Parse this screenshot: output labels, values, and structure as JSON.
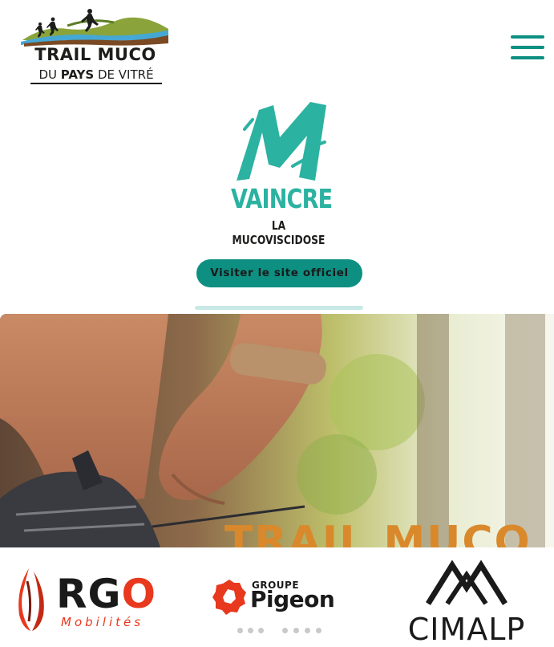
{
  "header": {
    "logo": {
      "title_line1": "TRAIL MUCO",
      "title_line2_prefix": "DU ",
      "title_line2_bold": "PAYS",
      "title_line2_suffix": " DE VITRÉ"
    },
    "menu_icon": "hamburger-menu-icon",
    "accent_color": "#0d8f82"
  },
  "association": {
    "logo_icon": "vaincre-m-icon",
    "name_line1": "VAINCRE",
    "name_line2": "LA MUCOVISCIDOSE",
    "brand_color": "#2bb2a1",
    "visit_button_label": "Visiter le site officiel"
  },
  "hero": {
    "title": "TRAIL MUCO",
    "image": "runner-tying-shoelace-photo"
  },
  "sponsors": {
    "items": [
      {
        "name": "RGO",
        "subtitle": "Mobilités",
        "icon": "rgo-logo-icon"
      },
      {
        "name_top": "GROUPE",
        "name": "Pigeon",
        "icon": "pigeon-badge-icon"
      },
      {
        "name": "CIMALP",
        "icon": "cimalp-mountains-icon"
      }
    ],
    "carousel_dots": 7
  }
}
